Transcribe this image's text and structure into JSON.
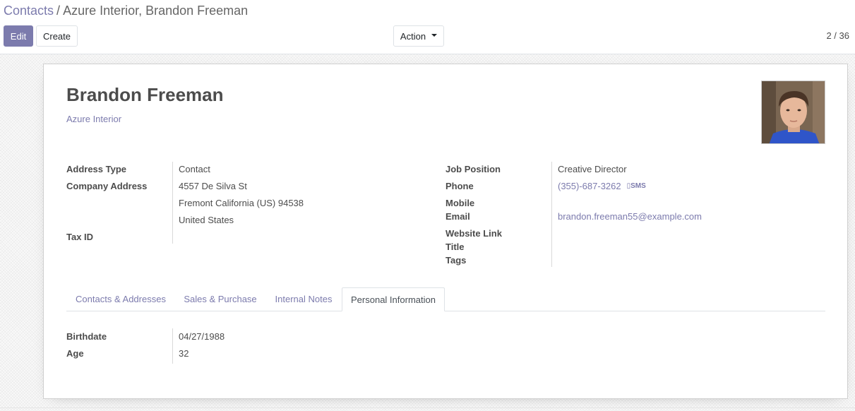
{
  "breadcrumb": {
    "parent": "Contacts",
    "separator": "/",
    "current": "Azure Interior, Brandon Freeman"
  },
  "toolbar": {
    "edit_label": "Edit",
    "create_label": "Create",
    "action_label": "Action",
    "pager": "2 / 36"
  },
  "record": {
    "name": "Brandon Freeman",
    "company": "Azure Interior",
    "left_fields": {
      "address_type_label": "Address Type",
      "address_type": "Contact",
      "company_address_label": "Company Address",
      "street": "4557 De Silva St",
      "city_line": "Fremont  California (US)  94538",
      "country": "United States",
      "tax_id_label": "Tax ID"
    },
    "right_fields": {
      "job_position_label": "Job Position",
      "job_position": "Creative Director",
      "phone_label": "Phone",
      "phone": "(355)-687-3262",
      "sms_label": "SMS",
      "mobile_label": "Mobile",
      "email_label": "Email",
      "email": "brandon.freeman55@example.com",
      "website_label": "Website Link",
      "title_label": "Title",
      "tags_label": "Tags"
    }
  },
  "tabs": [
    {
      "label": "Contacts & Addresses"
    },
    {
      "label": "Sales & Purchase"
    },
    {
      "label": "Internal Notes"
    },
    {
      "label": "Personal Information",
      "active": true
    }
  ],
  "personal": {
    "birthdate_label": "Birthdate",
    "birthdate": "04/27/1988",
    "age_label": "Age",
    "age": "32"
  },
  "colors": {
    "accent": "#7c7bad",
    "text": "#4c4c4c"
  },
  "icons": {
    "sms": "mobile-phone-icon",
    "dropdown": "caret-down-icon"
  }
}
